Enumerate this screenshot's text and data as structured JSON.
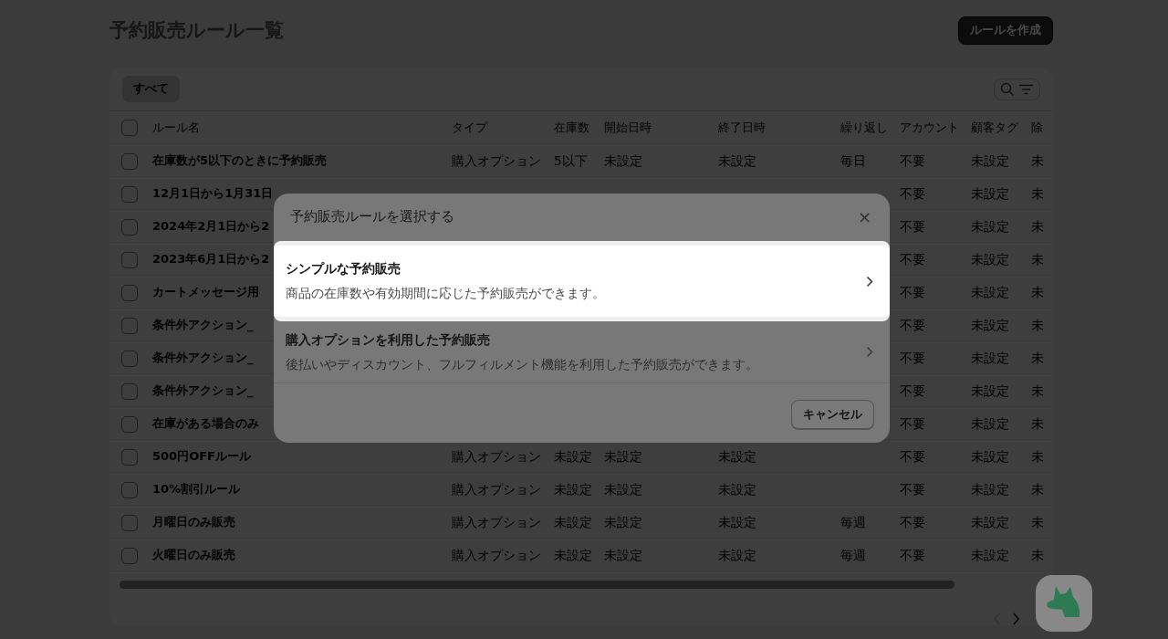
{
  "page": {
    "title": "予約販売ルール一覧",
    "create_button": "ルールを作成"
  },
  "filter_tabs": [
    {
      "label": "すべて",
      "selected": true
    }
  ],
  "table": {
    "select_all_checked": false,
    "columns": [
      "ルール名",
      "タイプ",
      "在庫数",
      "開始日時",
      "終了日時",
      "繰り返し",
      "アカウント",
      "顧客タグ",
      "除"
    ],
    "rows": [
      {
        "checked": false,
        "cells": [
          "在庫数が5以下のときに予約販売",
          "購入オプション",
          "5以下",
          "未設定",
          "未設定",
          "毎日",
          "不要",
          "未設定",
          "未"
        ]
      },
      {
        "checked": false,
        "cells": [
          "12月1日から1月31日",
          null,
          null,
          null,
          null,
          null,
          "不要",
          "未設定",
          "未"
        ]
      },
      {
        "checked": false,
        "cells": [
          "2024年2月1日から2",
          null,
          null,
          null,
          null,
          null,
          "不要",
          "未設定",
          "未"
        ]
      },
      {
        "checked": false,
        "cells": [
          "2023年6月1日から2",
          null,
          null,
          null,
          null,
          null,
          "不要",
          "未設定",
          "未"
        ]
      },
      {
        "checked": false,
        "cells": [
          "カートメッセージ用",
          null,
          null,
          null,
          null,
          null,
          "不要",
          "未設定",
          "未"
        ]
      },
      {
        "checked": false,
        "cells": [
          "条件外アクション_",
          null,
          null,
          null,
          null,
          null,
          "不要",
          "未設定",
          "未"
        ]
      },
      {
        "checked": false,
        "cells": [
          "条件外アクション_",
          null,
          null,
          null,
          null,
          null,
          "不要",
          "未設定",
          "未"
        ]
      },
      {
        "checked": false,
        "cells": [
          "条件外アクション_",
          null,
          null,
          null,
          null,
          null,
          "不要",
          "未設定",
          "未"
        ]
      },
      {
        "checked": false,
        "cells": [
          "在庫がある場合のみ",
          null,
          null,
          null,
          null,
          null,
          "不要",
          "未設定",
          "未"
        ]
      },
      {
        "checked": false,
        "cells": [
          "500円OFFルール",
          "購入オプション",
          "未設定",
          "未設定",
          "未設定",
          null,
          "不要",
          "未設定",
          "未"
        ]
      },
      {
        "checked": false,
        "cells": [
          "10%割引ルール",
          "購入オプション",
          "未設定",
          "未設定",
          "未設定",
          null,
          "不要",
          "未設定",
          "未"
        ]
      },
      {
        "checked": false,
        "cells": [
          "月曜日のみ販売",
          "購入オプション",
          "未設定",
          "未設定",
          "未設定",
          "毎週",
          "不要",
          "未設定",
          "未"
        ]
      },
      {
        "checked": false,
        "cells": [
          "火曜日のみ販売",
          "購入オプション",
          "未設定",
          "未設定",
          "未設定",
          "毎週",
          "不要",
          "未設定",
          "未"
        ]
      }
    ]
  },
  "dialog": {
    "title": "予約販売ルールを選択する",
    "close": "×",
    "options": [
      {
        "title": "シンプルな予約販売",
        "description": "商品の在庫数や有効期間に応じた予約販売ができます。",
        "selected": true
      },
      {
        "title": "購入オプションを利用した予約販売",
        "description": "後払いやディスカウント、フルフィルメント機能を利用した予約販売ができます。",
        "selected": false
      }
    ],
    "cancel_button": "キャンセル"
  }
}
